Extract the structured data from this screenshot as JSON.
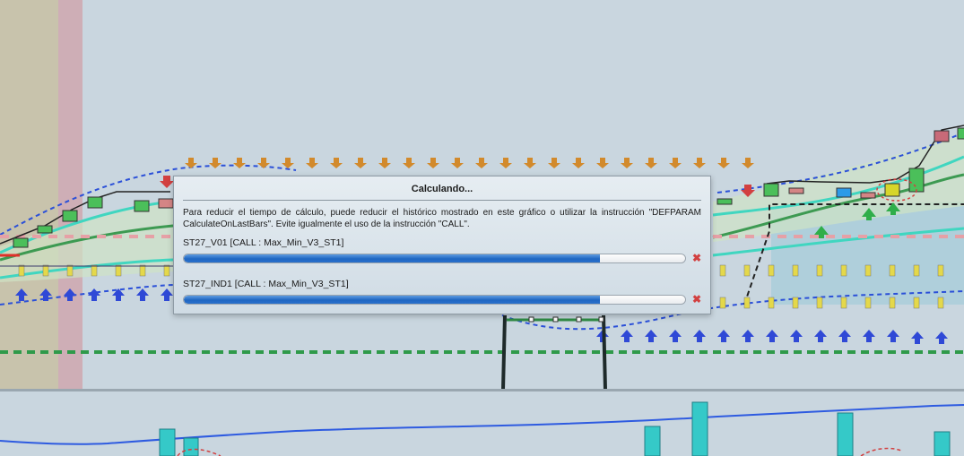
{
  "dialog": {
    "title": "Calculando...",
    "message": "Para reducir el tiempo de cálculo, puede reducir el histórico mostrado en este gráfico o utilizar la instrucción \"DEFPARAM CalculateOnLastBars\". Evite igualmente el uso de la instrucción \"CALL\".",
    "tasks": [
      {
        "label": "ST27_V01 [CALL : Max_Min_V3_ST1]",
        "progress": 0.83,
        "cancel_symbol": "✖"
      },
      {
        "label": "ST27_IND1 [CALL : Max_Min_V3_ST1]",
        "progress": 0.83,
        "cancel_symbol": "✖"
      }
    ]
  },
  "colors": {
    "chart_bg": "#c9d6df",
    "dashed_blue": "#2b50d8",
    "teal_band": "#40d6c0",
    "green_line": "#3d9a52",
    "arrow_orange": "#d28a2c",
    "arrow_blue": "#2f49d6",
    "histogram_teal": "#35c9c8",
    "oscillator_blue": "#2e5be0",
    "progress_blue": "#1f66c2"
  }
}
